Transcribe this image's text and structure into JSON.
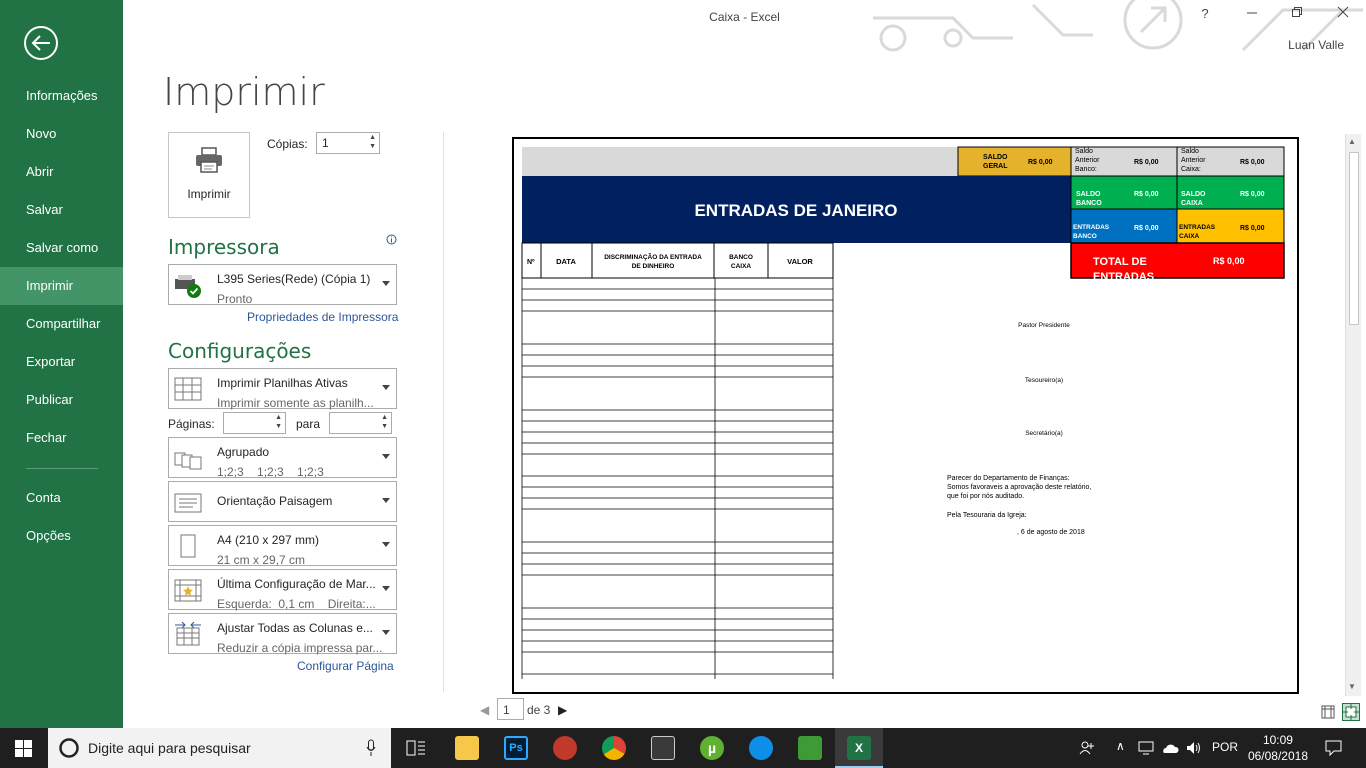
{
  "window": {
    "title": "Caixa - Excel",
    "help": "?",
    "user": "Luan Valle"
  },
  "sidebar": {
    "items": [
      {
        "label": "Informações"
      },
      {
        "label": "Novo"
      },
      {
        "label": "Abrir"
      },
      {
        "label": "Salvar"
      },
      {
        "label": "Salvar como"
      },
      {
        "label": "Imprimir"
      },
      {
        "label": "Compartilhar"
      },
      {
        "label": "Exportar"
      },
      {
        "label": "Publicar"
      },
      {
        "label": "Fechar"
      },
      {
        "label": "Conta"
      },
      {
        "label": "Opções"
      }
    ],
    "selected": "Imprimir"
  },
  "print": {
    "heading": "Imprimir",
    "button_label": "Imprimir",
    "copies_label": "Cópias:",
    "copies_value": "1"
  },
  "printer": {
    "heading": "Impressora",
    "name": "L395 Series(Rede) (Cópia 1)",
    "status": "Pronto",
    "properties_link": "Propriedades de Impressora"
  },
  "settings": {
    "heading": "Configurações",
    "what": {
      "title": "Imprimir Planilhas Ativas",
      "sub": "Imprimir somente as planilh..."
    },
    "pages_label": "Páginas:",
    "pages_to_label": "para",
    "collate": {
      "title": "Agrupado",
      "sub": "1;2;3    1;2;3    1;2;3"
    },
    "orientation": {
      "title": "Orientação Paisagem"
    },
    "paper": {
      "title": "A4 (210 x 297 mm)",
      "sub": "21 cm x 29,7 cm"
    },
    "margins": {
      "title": "Última Configuração de Mar...",
      "sub": "Esquerda:  0,1 cm    Direita:..."
    },
    "scaling": {
      "title": "Ajustar Todas as Colunas e...",
      "sub": "Reduzir a cópia impressa par..."
    },
    "page_setup_link": "Configurar Página"
  },
  "preview": {
    "saldo_geral_label": "SALDO GERAL",
    "saldo_geral_value": "R$ 0,00",
    "saldo_ant_banco_label": "Saldo Anterior Banco:",
    "saldo_ant_banco_value": "R$ 0,00",
    "saldo_ant_caixa_label": "Saldo Anterior Caixa:",
    "saldo_ant_caixa_value": "R$ 0,00",
    "saldo_banco_label": "SALDO BANCO",
    "saldo_banco_value": "R$ 0,00",
    "saldo_caixa_label": "SALDO CAIXA",
    "saldo_caixa_value": "R$ 0,00",
    "entradas_banco_label": "ENTRADAS BANCO",
    "entradas_banco_value": "R$ 0,00",
    "entradas_caixa_label": "ENTRADAS CAIXA",
    "entradas_caixa_value": "R$ 0,00",
    "title": "ENTRADAS DE JANEIRO",
    "total_label": "TOTAL DE ENTRADAS",
    "total_value": "R$ 0,00",
    "col_no": "Nº",
    "col_data": "DATA",
    "col_disc": "DISCRIMINAÇÃO DA ENTRADA DE DINHEIRO",
    "col_banco": "BANCO CAIXA",
    "col_valor": "VALOR",
    "pastor": "Pastor Presidente",
    "tesoureiro": "Tesoureiro(a)",
    "secretario": "Secretário(a)",
    "parecer1": "Parecer do Departamento de Finanças:",
    "parecer2": "Somos favoraveis a aprovação deste relatório,",
    "parecer3": "que foi por nós auditado.",
    "tesouraria": "Pela Tesouraria da Igreja:",
    "date": ", 6 de agosto de 2018"
  },
  "pager": {
    "current": "1",
    "total": "de 3"
  },
  "taskbar": {
    "search_placeholder": "Digite aqui para pesquisar",
    "lang": "POR",
    "time": "10:09",
    "date": "06/08/2018"
  },
  "colors": {
    "accent": "#217346",
    "navy": "#002060",
    "gold": "#e5b22c",
    "green": "#00b050",
    "blue": "#0070c0",
    "orange": "#ffc000",
    "red": "#ff0000"
  }
}
